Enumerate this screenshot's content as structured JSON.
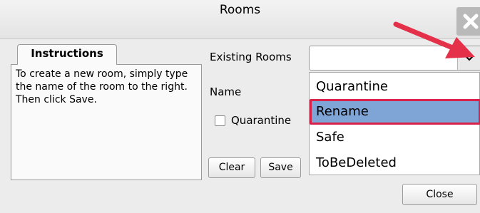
{
  "window": {
    "title": "Rooms",
    "close_icon": "close-x-icon"
  },
  "instructions": {
    "tab_label": "Instructions",
    "text": "To create a new room, simply type the name of the room to the right. Then click Save."
  },
  "form": {
    "existing_rooms_label": "Existing Rooms",
    "existing_rooms_value": "",
    "name_label": "Name",
    "quarantine_label": "Quarantine",
    "quarantine_checked": false
  },
  "dropdown": {
    "options": [
      "Quarantine",
      "Rename",
      "Safe",
      "ToBeDeleted"
    ],
    "selected_index": 1
  },
  "buttons": {
    "clear": "Clear",
    "save": "Save",
    "close": "Close"
  },
  "colors": {
    "annotation_arrow": "#e5304a",
    "selection_bg": "#7fa5d6",
    "selection_border": "#d8224a"
  }
}
